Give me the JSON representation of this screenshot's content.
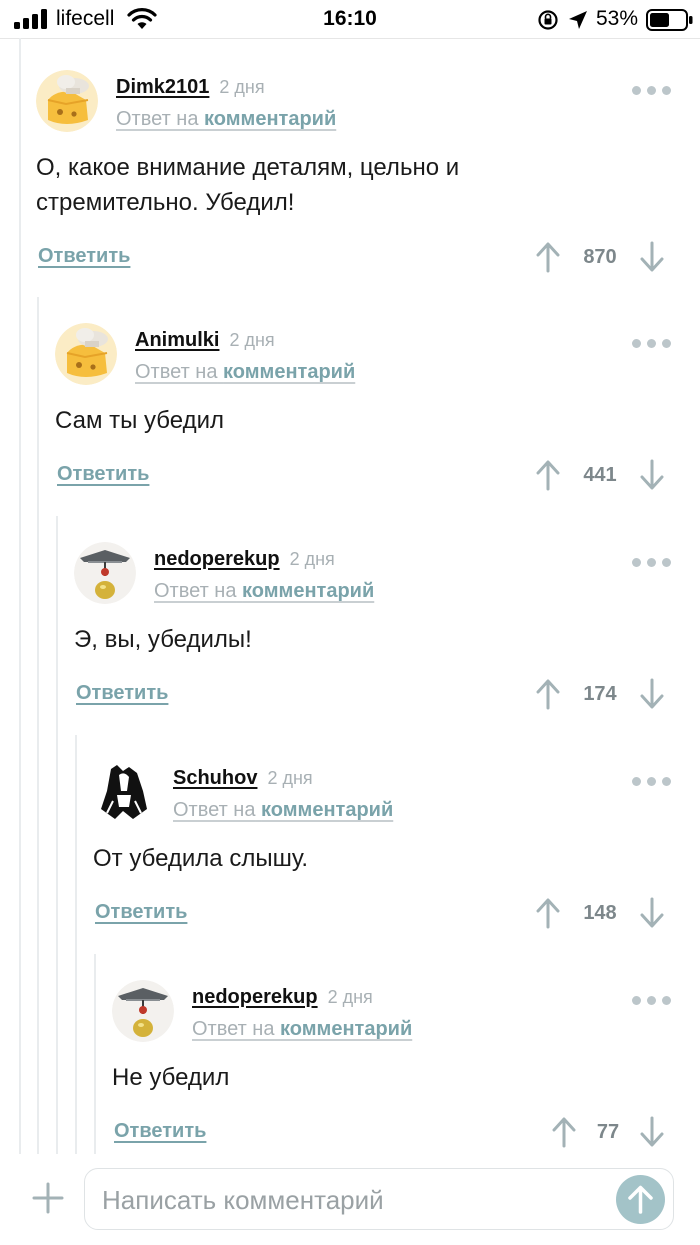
{
  "status_bar": {
    "carrier": "lifecell",
    "time": "16:10",
    "battery_percent": "53%",
    "battery_level": 0.53
  },
  "comments": [
    {
      "author": "Dimk2101",
      "date": "2 дня",
      "reply_prefix": "Ответ на",
      "reply_link": "комментарий",
      "lines": [
        "О, какое внимание деталям, цельно и",
        "стремительно. Убедил!"
      ],
      "reply_label": "Ответить",
      "rating": "870",
      "avatar_icon": "cook-hat-cheese-avatar-icon"
    },
    {
      "author": "Animulki",
      "date": "2 дня",
      "reply_prefix": "Ответ на",
      "reply_link": "комментарий",
      "lines": [
        "Сам ты убедил"
      ],
      "reply_label": "Ответить",
      "rating": "441",
      "avatar_icon": "cook-hat-cheese-avatar-icon"
    },
    {
      "author": "nedoperekup",
      "date": "2 дня",
      "reply_prefix": "Ответ на",
      "reply_link": "комментарий",
      "lines": [
        "Э, вы, убедилы!"
      ],
      "reply_label": "Ответить",
      "rating": "174",
      "avatar_icon": "pendulum-avatar-icon"
    },
    {
      "author": "Schuhov",
      "date": "2 дня",
      "reply_prefix": "Ответ на",
      "reply_link": "комментарий",
      "lines": [
        "От убедила слышу."
      ],
      "reply_label": "Ответить",
      "rating": "148",
      "avatar_icon": "ink-sketch-avatar-icon"
    },
    {
      "author": "nedoperekup",
      "date": "2 дня",
      "reply_prefix": "Ответ на",
      "reply_link": "комментарий",
      "lines": [
        "Не убедил"
      ],
      "reply_label": "Ответить",
      "rating": "77",
      "avatar_icon": "pendulum-avatar-icon"
    }
  ],
  "composer": {
    "placeholder": "Написать комментарий"
  },
  "colors": {
    "link": "#7aa3aa",
    "muted": "#a8b0b4",
    "send_button": "#a3c3c8",
    "thread_line": "#e9ecee"
  }
}
